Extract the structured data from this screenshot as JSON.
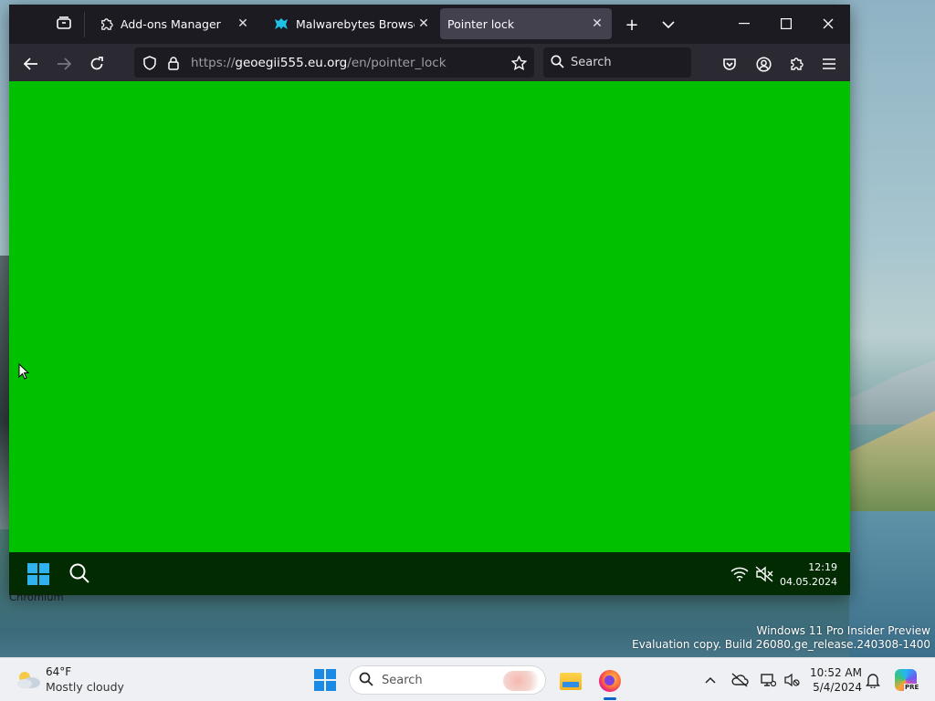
{
  "browser": {
    "tabs": [
      {
        "label": "Add-ons Manager",
        "icon": "puzzle-icon",
        "active": false
      },
      {
        "label": "Malwarebytes Browser Gu",
        "icon": "malwarebytes-icon",
        "active": false
      },
      {
        "label": "Pointer lock",
        "icon": "",
        "active": true
      }
    ],
    "url": {
      "prefix": "https://",
      "host": "geoegii555.eu.org",
      "path": "/en/pointer_lock"
    },
    "search_placeholder": "Search"
  },
  "page": {
    "background_color": "#00c000"
  },
  "inner_taskbar": {
    "time": "12:19",
    "date": "04.05.2024"
  },
  "desktop": {
    "icon_label": "Chromium",
    "watermark_line1": "Windows 11 Pro Insider Preview",
    "watermark_line2": "Evaluation copy. Build 26080.ge_release.240308-1400"
  },
  "taskbar": {
    "weather_temp": "64°F",
    "weather_desc": "Mostly cloudy",
    "search_placeholder": "Search",
    "time": "10:52 AM",
    "date": "5/4/2024",
    "copilot_badge": "PRE"
  },
  "colors": {
    "accent": "#0a64c8",
    "tab_active": "#42414d",
    "toolbar": "#2b2a33"
  }
}
